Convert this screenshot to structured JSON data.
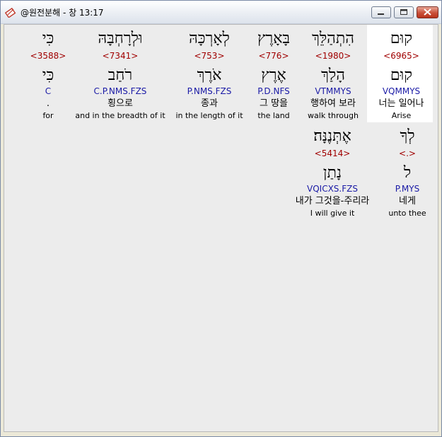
{
  "window": {
    "title": "@원전분해 - 창 13:17",
    "buttons": {
      "minimize": "minimize",
      "maximize": "maximize",
      "close": "close"
    }
  },
  "verse_rows": [
    [
      {
        "hebrew": "קוּם",
        "strong": "<6965>",
        "lemma": "קוּם",
        "morph": "VQMMYS",
        "korean": "너는 일어나",
        "english": "Arise",
        "highlight": true
      },
      {
        "hebrew": "הִתְהַלֵּךְ",
        "strong": "<1980>",
        "lemma": "הָלַךְ",
        "morph": "VTMMYS",
        "korean": "행하여 보라",
        "english": "walk through"
      },
      {
        "hebrew": "בָּאָרֶץ",
        "strong": "<776>",
        "lemma": "אֶרֶץ",
        "morph": "P.D.NFS",
        "korean": "그 땅을",
        "english": "the land"
      },
      {
        "hebrew": "לְאָרְכָּהּ",
        "strong": "<753>",
        "lemma": "אֹרֶךְ",
        "morph": "P.NMS.FZS",
        "korean": "종과",
        "english": "in the length of it"
      },
      {
        "hebrew": "וּלְרָחְבָּהּ",
        "strong": "<7341>",
        "lemma": "רֹחַב",
        "morph": "C.P.NMS.FZS",
        "korean": "횡으로",
        "english": "and in the breadth of it"
      },
      {
        "hebrew": "כִּי",
        "strong": "<3588>",
        "lemma": "כִּי",
        "morph": "C",
        "korean": ".",
        "english": "for"
      }
    ],
    [
      {
        "hebrew": "לְךָ",
        "strong": "<.>",
        "lemma": "ל",
        "morph": "P.MYS",
        "korean": "네게",
        "english": "unto thee"
      },
      {
        "hebrew": "אֶתְּנֶנָּה׃",
        "strong": "<5414>",
        "lemma": "נָתַן",
        "morph": "VQICXS.FZS",
        "korean": "내가 그것을-주리라",
        "english": "I will give it"
      }
    ]
  ]
}
